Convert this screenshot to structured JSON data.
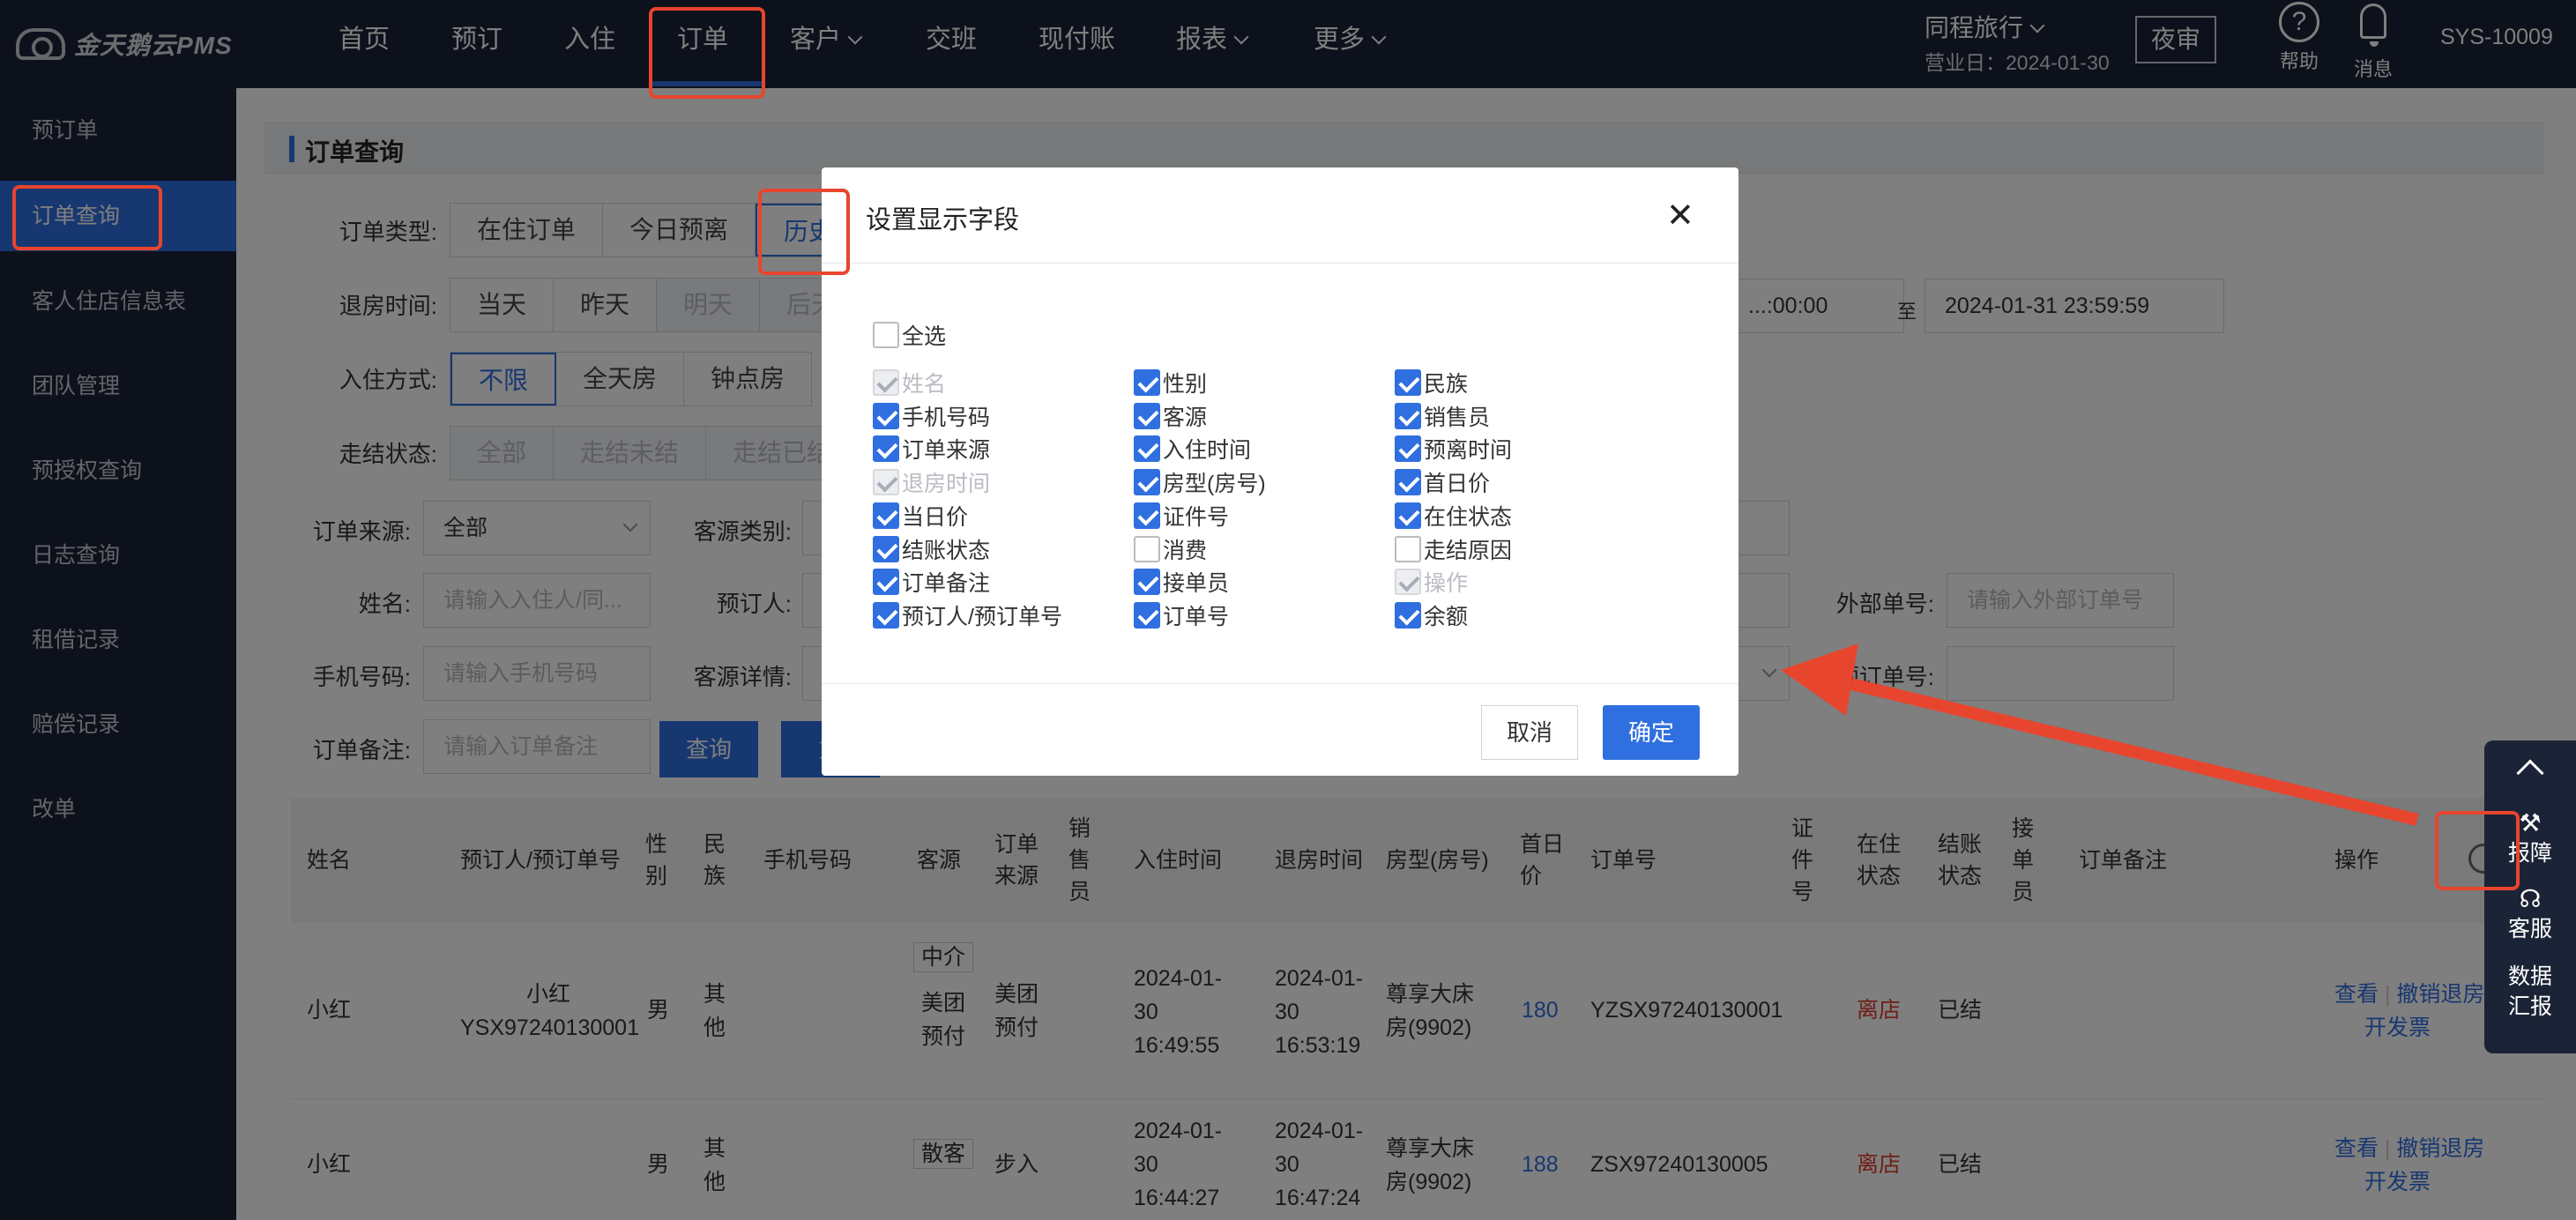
{
  "app": {
    "name": "金天鹅云PMS"
  },
  "nav": {
    "items": [
      "首页",
      "预订",
      "入住",
      "订单",
      "客户",
      "交班",
      "现付账",
      "报表",
      "更多"
    ],
    "active": "订单"
  },
  "header": {
    "org": "同程旅行",
    "business_date": "营业日：2024-01-30",
    "night_audit": "夜审",
    "help": "帮助",
    "messages": "消息",
    "user": "SYS-10009"
  },
  "sidebar": {
    "items": [
      "预订单",
      "订单查询",
      "客人住店信息表",
      "团队管理",
      "预授权查询",
      "日志查询",
      "租借记录",
      "赔偿记录",
      "改单"
    ],
    "active": "订单查询"
  },
  "page": {
    "title": "订单查询"
  },
  "filters": {
    "order_type": {
      "label": "订单类型:",
      "options": [
        "在住订单",
        "今日预离",
        "历史"
      ]
    },
    "checkout_time": {
      "label": "退房时间:",
      "options": [
        "当天",
        "昨天",
        "明天",
        "后天"
      ],
      "start": "...:00:00",
      "to": "至",
      "end": "2024-01-31 23:59:59"
    },
    "checkin_mode": {
      "label": "入住方式:",
      "options": [
        "不限",
        "全天房",
        "钟点房"
      ]
    },
    "settle_status": {
      "label": "走结状态:",
      "options": [
        "全部",
        "走结未结",
        "走结已结"
      ]
    },
    "order_source": {
      "label": "订单来源:",
      "value": "全部"
    },
    "guest_type": {
      "label": "客源类别:"
    },
    "name": {
      "label": "姓名:",
      "placeholder": "请输入入住人/同..."
    },
    "booker": {
      "label": "预订人:"
    },
    "external_no": {
      "label": "外部单号:",
      "placeholder": "请输入外部订单号"
    },
    "phone": {
      "label": "手机号码:",
      "placeholder": "请输入手机号码"
    },
    "guest_detail": {
      "label": "客源详情:"
    },
    "booking_no": {
      "label": "预订单号:"
    },
    "remark": {
      "label": "订单备注:",
      "placeholder": "请输入订单备注"
    },
    "query_btn": "查询",
    "reset_btn": "重"
  },
  "table": {
    "headers": [
      "姓名",
      "预订人/预订单号",
      "性别",
      "民族",
      "手机号码",
      "客源",
      "订单来源",
      "销售员",
      "入住时间",
      "退房时间",
      "房型(房号)",
      "首日价",
      "订单号",
      "证件号",
      "在住状态",
      "结账状态",
      "接单员",
      "订单备注",
      "操作"
    ],
    "rows": [
      {
        "name": "小红",
        "booker": "小红",
        "booker_no": "YSX97240130001",
        "gender": "男",
        "ethnic": "其他",
        "tag": "中介",
        "source_a": "美团",
        "source_b": "预付",
        "order_src_a": "美团",
        "order_src_b": "预付",
        "checkin_a": "2024-01-",
        "checkin_b": "30",
        "checkin_c": "16:49:55",
        "checkout_a": "2024-01-",
        "checkout_b": "30",
        "checkout_c": "16:53:19",
        "room_a": "尊享大床",
        "room_b": "房(9902)",
        "price": "180",
        "order_no": "YZSX97240130001",
        "status": "离店",
        "settle": "已结",
        "op_view": "查看",
        "op_undo": "撤销退房",
        "op_invoice": "开发票"
      },
      {
        "name": "小红",
        "booker": "",
        "booker_no": "",
        "gender": "男",
        "ethnic": "其他",
        "tag": "散客",
        "source_a": "",
        "source_b": "",
        "order_src_a": "步入",
        "order_src_b": "",
        "checkin_a": "2024-01-",
        "checkin_b": "30",
        "checkin_c": "16:44:27",
        "checkout_a": "2024-01-",
        "checkout_b": "30",
        "checkout_c": "16:47:24",
        "room_a": "尊享大床",
        "room_b": "房(9902)",
        "price": "188",
        "order_no": "ZSX97240130005",
        "status": "离店",
        "settle": "已结",
        "op_view": "查看",
        "op_undo": "撤销退房",
        "op_invoice": "开发票"
      }
    ]
  },
  "float_panel": {
    "report_issue": "报障",
    "service": "客服",
    "data_report_a": "数据",
    "data_report_b": "汇报"
  },
  "dialog": {
    "title": "设置显示字段",
    "select_all": "全选",
    "fields": [
      {
        "label": "姓名",
        "state": "disabled"
      },
      {
        "label": "性别",
        "state": "checked"
      },
      {
        "label": "民族",
        "state": "checked"
      },
      {
        "label": "手机号码",
        "state": "checked"
      },
      {
        "label": "客源",
        "state": "checked"
      },
      {
        "label": "销售员",
        "state": "checked"
      },
      {
        "label": "订单来源",
        "state": "checked"
      },
      {
        "label": "入住时间",
        "state": "checked"
      },
      {
        "label": "预离时间",
        "state": "checked"
      },
      {
        "label": "退房时间",
        "state": "disabled"
      },
      {
        "label": "房型(房号)",
        "state": "checked"
      },
      {
        "label": "首日价",
        "state": "checked"
      },
      {
        "label": "当日价",
        "state": "checked"
      },
      {
        "label": "证件号",
        "state": "checked"
      },
      {
        "label": "在住状态",
        "state": "checked"
      },
      {
        "label": "结账状态",
        "state": "checked"
      },
      {
        "label": "消费",
        "state": "unchecked"
      },
      {
        "label": "走结原因",
        "state": "unchecked"
      },
      {
        "label": "订单备注",
        "state": "checked"
      },
      {
        "label": "接单员",
        "state": "checked"
      },
      {
        "label": "操作",
        "state": "disabled"
      },
      {
        "label": "预订人/预订单号",
        "state": "checked"
      },
      {
        "label": "订单号",
        "state": "checked"
      },
      {
        "label": "余额",
        "state": "checked"
      }
    ],
    "cancel": "取消",
    "ok": "确定"
  },
  "colors": {
    "nav_bg": "#1b2336",
    "accent": "#2f6fe0",
    "annotation": "#e8452e",
    "status_red": "#e03b2b"
  }
}
